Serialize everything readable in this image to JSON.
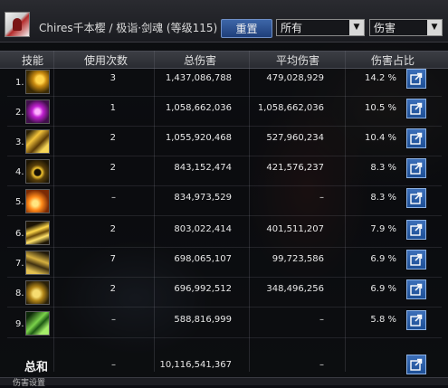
{
  "header": {
    "character": "Chires千本樱 / 极诣·剑魂 (等级115)",
    "reset_label": "重置",
    "filter_target": "所有",
    "filter_type": "伤害"
  },
  "columns": [
    "技能",
    "使用次数",
    "总伤害",
    "平均伤害",
    "伤害占比"
  ],
  "rows": [
    {
      "index": "1.",
      "uses": "3",
      "total": "1,437,086,788",
      "avg": "479,028,929",
      "pct": "14.2 %",
      "icon": "crescent-slash-icon"
    },
    {
      "index": "2.",
      "uses": "1",
      "total": "1,058,662,036",
      "avg": "1,058,662,036",
      "pct": "10.5 %",
      "icon": "purple-burst-icon"
    },
    {
      "index": "3.",
      "uses": "2",
      "total": "1,055,920,468",
      "avg": "527,960,234",
      "pct": "10.4 %",
      "icon": "sword-rain-icon"
    },
    {
      "index": "4.",
      "uses": "2",
      "total": "843,152,474",
      "avg": "421,576,237",
      "pct": "8.3 %",
      "icon": "ring-slash-icon"
    },
    {
      "index": "5.",
      "uses": "–",
      "total": "834,973,529",
      "avg": "–",
      "pct": "8.3 %",
      "icon": "flame-burst-icon"
    },
    {
      "index": "6.",
      "uses": "2",
      "total": "803,022,414",
      "avg": "401,511,207",
      "pct": "7.9 %",
      "icon": "lightning-strike-icon"
    },
    {
      "index": "7.",
      "uses": "7",
      "total": "698,065,107",
      "avg": "99,723,586",
      "pct": "6.9 %",
      "icon": "flow-slash-icon"
    },
    {
      "index": "8.",
      "uses": "2",
      "total": "696,992,512",
      "avg": "348,496,256",
      "pct": "6.9 %",
      "icon": "wave-slash-icon"
    },
    {
      "index": "9.",
      "uses": "–",
      "total": "588,816,999",
      "avg": "–",
      "pct": "5.8 %",
      "icon": "green-blade-icon"
    }
  ],
  "totals": {
    "label": "总和",
    "uses": "–",
    "total": "10,116,541,367",
    "avg": "–"
  },
  "bottom_cut_text": "伤害设置"
}
